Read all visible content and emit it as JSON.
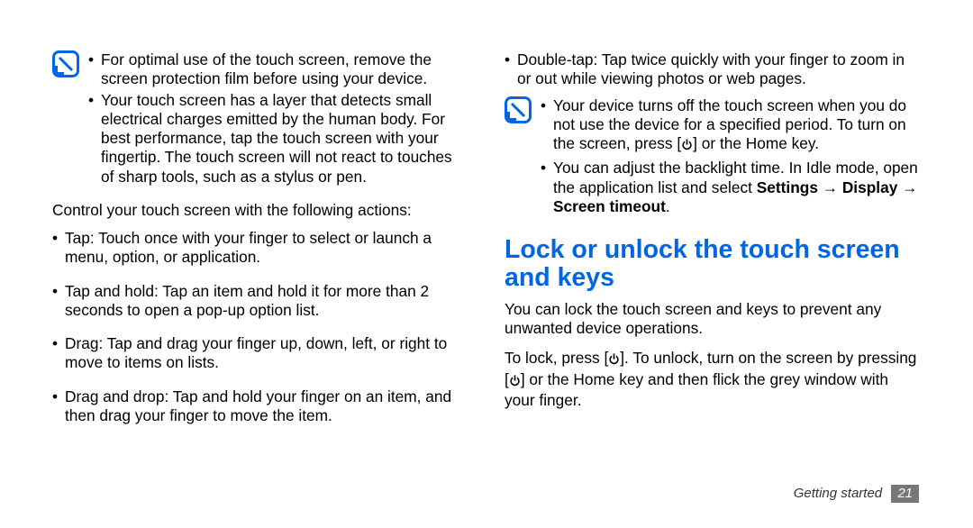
{
  "left": {
    "note1": {
      "items": [
        "For optimal use of the touch screen, remove the screen protection film before using your device.",
        "Your touch screen has a layer that detects small electrical charges emitted by the human body. For best performance, tap the touch screen with your fingertip. The touch screen will not react to touches of sharp tools, such as a stylus or pen."
      ]
    },
    "intro": "Control your touch screen with the following actions:",
    "actions": [
      "Tap: Touch once with your finger to select or launch a menu, option, or application.",
      "Tap and hold: Tap an item and hold it for more than 2 seconds to open a pop-up option list.",
      "Drag: Tap and drag your finger up, down, left, or right to move to items on lists.",
      "Drag and drop: Tap and hold your finger on an item, and then drag your finger to move the item."
    ]
  },
  "right": {
    "actions_cont": [
      "Double-tap: Tap twice quickly with your finger to zoom in or out while viewing photos or web pages."
    ],
    "note2": {
      "item1_a": "Your device turns off the touch screen when you do not use the device for a specified period. To turn on the screen, press [",
      "item1_b": "] or the Home key.",
      "item2_a": "You can adjust the backlight time. In Idle mode, open the application list and select ",
      "item2_bold1": "Settings",
      "item2_arrow1": " → ",
      "item2_bold2": "Display",
      "item2_arrow2": " → ",
      "item2_bold3": "Screen timeout",
      "item2_end": "."
    },
    "heading": "Lock or unlock the touch screen and keys",
    "body1": "You can lock the touch screen and keys to prevent any unwanted device operations.",
    "body2_a": "To lock, press [",
    "body2_b": "]. To unlock, turn on the screen by pressing [",
    "body2_c": "] or the Home key and then flick the grey window with your finger."
  },
  "footer": {
    "section": "Getting started",
    "page": "21"
  }
}
